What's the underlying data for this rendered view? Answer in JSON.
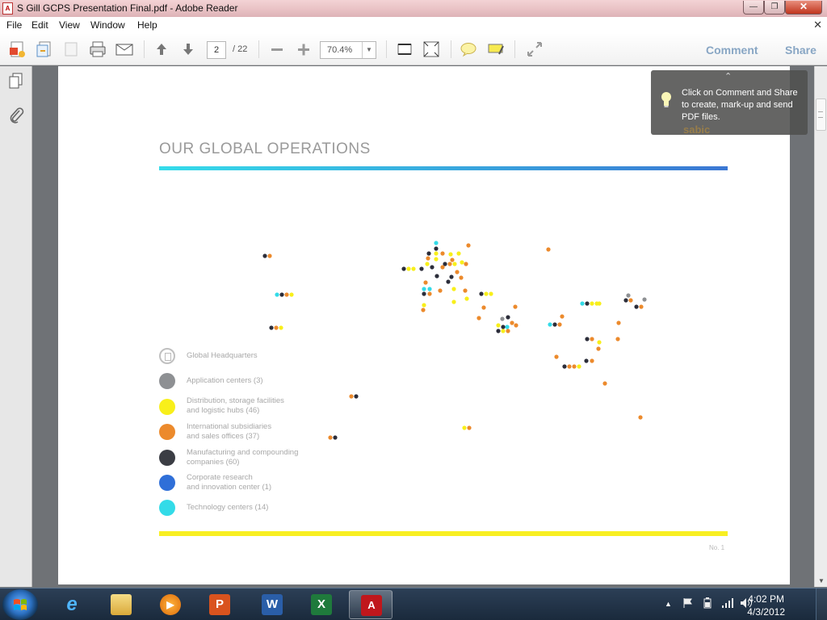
{
  "window": {
    "title": "S Gill GCPS Presentation Final.pdf - Adobe Reader",
    "minimize_label": "—",
    "maximize_label": "❐",
    "close_label": "✕"
  },
  "menu": {
    "items": [
      "File",
      "Edit",
      "View",
      "Window",
      "Help"
    ],
    "doc_close": "✕"
  },
  "toolbar": {
    "current_page": "2",
    "total_pages": "/ 22",
    "zoom": "70.4%",
    "comment_label": "Comment",
    "share_label": "Share"
  },
  "tooltip": {
    "message": "Click on Comment and Share to create, mark-up and send PDF files.",
    "logo_text": "sabic"
  },
  "slide": {
    "title": "OUR GLOBAL OPERATIONS",
    "page_no": "No. 1",
    "legend": [
      {
        "label": "Global Headquarters",
        "color": "#ffffff"
      },
      {
        "label": "Application centers (3)",
        "color": "#8e9093"
      },
      {
        "label": "Distribution, storage facilities\nand logistic hubs (46)",
        "color": "#f8ef1a"
      },
      {
        "label": "International subsidiaries\nand sales offices (37)",
        "color": "#ec8a2c"
      },
      {
        "label": "Manufacturing and compounding\ncompanies (60)",
        "color": "#3b3d44"
      },
      {
        "label": "Corporate research\nand innovation center (1)",
        "color": "#2f6fd8"
      },
      {
        "label": "Technology centers (14)",
        "color": "#33dbe8"
      }
    ]
  },
  "taskbar": {
    "apps": [
      "internet-explorer",
      "file-explorer",
      "media-player",
      "powerpoint",
      "word",
      "excel",
      "adobe-reader"
    ],
    "time": "4:02 PM",
    "date": "4/3/2012"
  }
}
